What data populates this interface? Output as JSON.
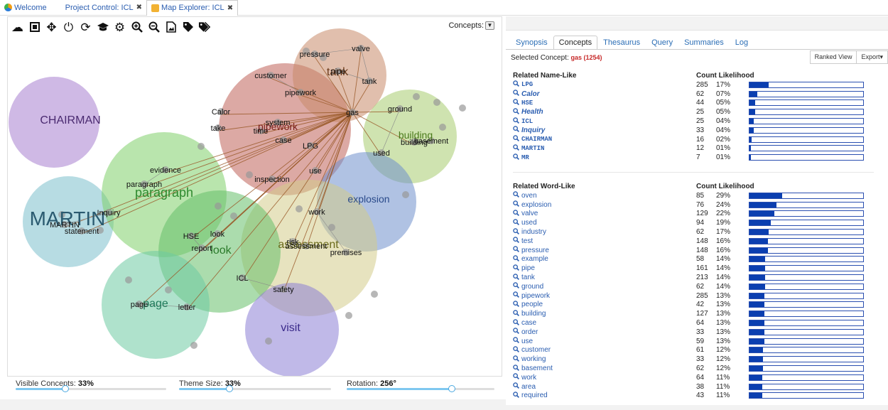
{
  "tabs": [
    {
      "label": "Welcome",
      "icon": "welcome-icon",
      "closable": false
    },
    {
      "label": "Project Control: ICL",
      "icon": "",
      "closable": true
    },
    {
      "label": "Map Explorer: ICL",
      "icon": "map-icon",
      "closable": true,
      "active": true
    }
  ],
  "close_glyph": "✖",
  "toolbar": {
    "icons": [
      "cloud-icon",
      "frame-icon",
      "move-icon",
      "power-icon",
      "refresh-icon",
      "graduation-cap-icon",
      "cogs-icon",
      "zoom-in-icon",
      "zoom-out-icon",
      "export-image-icon",
      "tag-icon",
      "tags-icon"
    ],
    "concepts_label": "Concepts:"
  },
  "map": {
    "themes": [
      {
        "label": "CHAIRMAN",
        "color": "#a77fd0"
      },
      {
        "label": "MARTIN",
        "color": "#7bbfcc"
      },
      {
        "label": "paragraph",
        "color": "#7fcf6a"
      },
      {
        "label": "pipework",
        "color": "#c0625a"
      },
      {
        "label": "tank",
        "color": "#c98a6a"
      },
      {
        "label": "building",
        "color": "#a8cc70"
      },
      {
        "label": "explosion",
        "color": "#6f8fcc"
      },
      {
        "label": "assessment",
        "color": "#d4cc8a"
      },
      {
        "label": "look",
        "color": "#66c06a"
      },
      {
        "label": "page",
        "color": "#6ecba2"
      },
      {
        "label": "visit",
        "color": "#8c7fd6"
      }
    ],
    "concepts": [
      "pressure",
      "valve",
      "customer",
      "pipe",
      "tank",
      "pipework",
      "gas",
      "ground",
      "Calor",
      "system",
      "take",
      "time",
      "case",
      "LPG",
      "basement",
      "building",
      "used",
      "evidence",
      "paragraph",
      "use",
      "inspection",
      "Inquiry",
      "MARTIN",
      "statement",
      "work",
      "HSE",
      "look",
      "report",
      "risk",
      "assessment",
      "premises",
      "ICL",
      "safety",
      "page",
      "letter"
    ],
    "hub": "gas"
  },
  "sliders": [
    {
      "label": "Visible Concepts:",
      "value": "33%",
      "fraction": 0.33
    },
    {
      "label": "Theme Size:",
      "value": "33%",
      "fraction": 0.33
    },
    {
      "label": "Rotation:",
      "value": "256°",
      "fraction": 0.711
    }
  ],
  "right": {
    "tabs": [
      "Synopsis",
      "Concepts",
      "Thesaurus",
      "Query",
      "Summaries",
      "Log"
    ],
    "active_tab": "Concepts",
    "selected_label": "Selected Concept:",
    "selected_value": "gas (1254)",
    "buttons": {
      "ranked": "Ranked View",
      "export": "Export▾"
    },
    "name_like": {
      "title": "Related Name-Like",
      "col": "Count Likelihood",
      "rows": [
        {
          "name": "LPG",
          "count": "285",
          "pct": "17%",
          "frac": 0.17,
          "style": "mono"
        },
        {
          "name": "Calor",
          "count": "62",
          "pct": "07%",
          "frac": 0.07,
          "style": "it"
        },
        {
          "name": "HSE",
          "count": "44",
          "pct": "05%",
          "frac": 0.05,
          "style": "mono"
        },
        {
          "name": "Health",
          "count": "25",
          "pct": "05%",
          "frac": 0.05,
          "style": "it"
        },
        {
          "name": "ICL",
          "count": "25",
          "pct": "04%",
          "frac": 0.04,
          "style": "mono"
        },
        {
          "name": "Inquiry",
          "count": "33",
          "pct": "04%",
          "frac": 0.04,
          "style": "it"
        },
        {
          "name": "CHAIRMAN",
          "count": "16",
          "pct": "02%",
          "frac": 0.02,
          "style": "mono"
        },
        {
          "name": "MARTIN",
          "count": "12",
          "pct": "01%",
          "frac": 0.01,
          "style": "mono"
        },
        {
          "name": "MR",
          "count": "7",
          "pct": "01%",
          "frac": 0.01,
          "style": "mono"
        }
      ]
    },
    "word_like": {
      "title": "Related Word-Like",
      "col": "Count Likelihood",
      "rows": [
        {
          "name": "oven",
          "count": "85",
          "pct": "29%",
          "frac": 0.29
        },
        {
          "name": "explosion",
          "count": "76",
          "pct": "24%",
          "frac": 0.24
        },
        {
          "name": "valve",
          "count": "129",
          "pct": "22%",
          "frac": 0.22
        },
        {
          "name": "used",
          "count": "94",
          "pct": "19%",
          "frac": 0.19
        },
        {
          "name": "industry",
          "count": "62",
          "pct": "17%",
          "frac": 0.17
        },
        {
          "name": "test",
          "count": "148",
          "pct": "16%",
          "frac": 0.16
        },
        {
          "name": "pressure",
          "count": "148",
          "pct": "16%",
          "frac": 0.16
        },
        {
          "name": "example",
          "count": "58",
          "pct": "14%",
          "frac": 0.14
        },
        {
          "name": "pipe",
          "count": "161",
          "pct": "14%",
          "frac": 0.14
        },
        {
          "name": "tank",
          "count": "213",
          "pct": "14%",
          "frac": 0.14
        },
        {
          "name": "ground",
          "count": "62",
          "pct": "14%",
          "frac": 0.14
        },
        {
          "name": "pipework",
          "count": "285",
          "pct": "13%",
          "frac": 0.13
        },
        {
          "name": "people",
          "count": "42",
          "pct": "13%",
          "frac": 0.13
        },
        {
          "name": "building",
          "count": "127",
          "pct": "13%",
          "frac": 0.13
        },
        {
          "name": "case",
          "count": "64",
          "pct": "13%",
          "frac": 0.13
        },
        {
          "name": "order",
          "count": "33",
          "pct": "13%",
          "frac": 0.13
        },
        {
          "name": "use",
          "count": "59",
          "pct": "13%",
          "frac": 0.13
        },
        {
          "name": "customer",
          "count": "61",
          "pct": "12%",
          "frac": 0.12
        },
        {
          "name": "working",
          "count": "33",
          "pct": "12%",
          "frac": 0.12
        },
        {
          "name": "basement",
          "count": "62",
          "pct": "12%",
          "frac": 0.12
        },
        {
          "name": "work",
          "count": "64",
          "pct": "11%",
          "frac": 0.11
        },
        {
          "name": "area",
          "count": "38",
          "pct": "11%",
          "frac": 0.11
        },
        {
          "name": "required",
          "count": "43",
          "pct": "11%",
          "frac": 0.11
        }
      ]
    }
  }
}
